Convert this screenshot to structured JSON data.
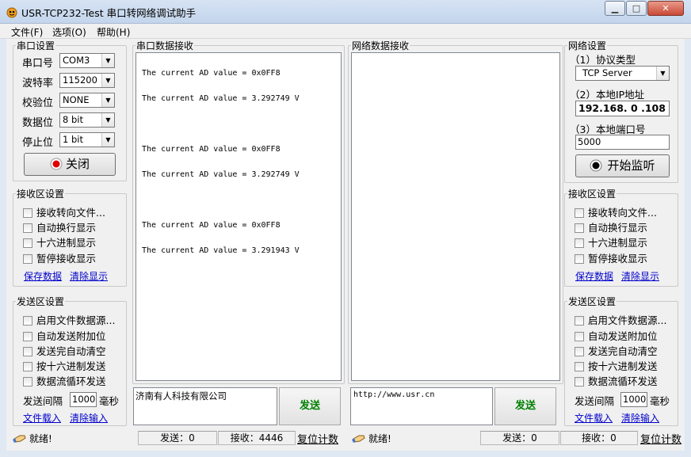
{
  "window": {
    "title": "USR-TCP232-Test 串口转网络调试助手",
    "buttons": {
      "minimize": "▁",
      "maximize": "□",
      "close": "✕"
    }
  },
  "menu": [
    "文件(F)",
    "选项(O)",
    "帮助(H)"
  ],
  "serial_settings": {
    "legend": "串口设置",
    "port_label": "串口号",
    "port_value": "COM3",
    "baud_label": "波特率",
    "baud_value": "115200",
    "parity_label": "校验位",
    "parity_value": "NONE",
    "databits_label": "数据位",
    "databits_value": "8 bit",
    "stopbits_label": "停止位",
    "stopbits_value": "1 bit",
    "close_button": "关闭"
  },
  "left_receive": {
    "legend": "接收区设置",
    "options": [
      "接收转向文件...",
      "自动换行显示",
      "十六进制显示",
      "暂停接收显示"
    ],
    "save_link": "保存数据",
    "clear_link": "清除显示"
  },
  "left_send": {
    "legend": "发送区设置",
    "options": [
      "启用文件数据源...",
      "自动发送附加位",
      "发送完自动清空",
      "按十六进制发送",
      "数据流循环发送"
    ],
    "interval_label": "发送间隔",
    "interval_value": "1000",
    "interval_unit": "毫秒",
    "load_link": "文件载入",
    "clear_link": "清除输入"
  },
  "serial_receive": {
    "legend": "串口数据接收",
    "lines": [
      "The current AD value = 0x0FF8",
      "The current AD value = 3.292749 V",
      "The current AD value = 0x0FF8",
      "The current AD value = 3.292749 V",
      "The current AD value = 0x0FF8",
      "The current AD value = 3.291943 V"
    ]
  },
  "network_receive": {
    "legend": "网络数据接收"
  },
  "serial_send": {
    "text": "济南有人科技有限公司",
    "send_button": "发送"
  },
  "network_send": {
    "text": "http://www.usr.cn",
    "send_button": "发送"
  },
  "network_settings": {
    "legend": "网络设置",
    "protocol_label": "（1）协议类型",
    "protocol_value": "TCP Server",
    "ip_label": "（2）本地IP地址",
    "ip_value": "192.168. 0 .108",
    "port_label": "（3）本地端口号",
    "port_value": "5000",
    "listen_button": "开始监听"
  },
  "right_receive": {
    "legend": "接收区设置",
    "options": [
      "接收转向文件...",
      "自动换行显示",
      "十六进制显示",
      "暂停接收显示"
    ],
    "save_link": "保存数据",
    "clear_link": "清除显示"
  },
  "right_send": {
    "legend": "发送区设置",
    "options": [
      "启用文件数据源...",
      "自动发送附加位",
      "发送完自动清空",
      "按十六进制发送",
      "数据流循环发送"
    ],
    "interval_label": "发送间隔",
    "interval_value": "1000",
    "interval_unit": "毫秒",
    "load_link": "文件载入",
    "clear_link": "清除输入"
  },
  "status_left": {
    "ready": "就绪!",
    "sent": "发送：0",
    "received": "接收：4446",
    "reset": "复位计数"
  },
  "status_right": {
    "ready": "就绪!",
    "sent": "发送：0",
    "received": "接收：0",
    "reset": "复位计数"
  },
  "colors": {
    "send_green": "#008000",
    "record_red": "#e00000",
    "link_blue": "#0000cc"
  }
}
